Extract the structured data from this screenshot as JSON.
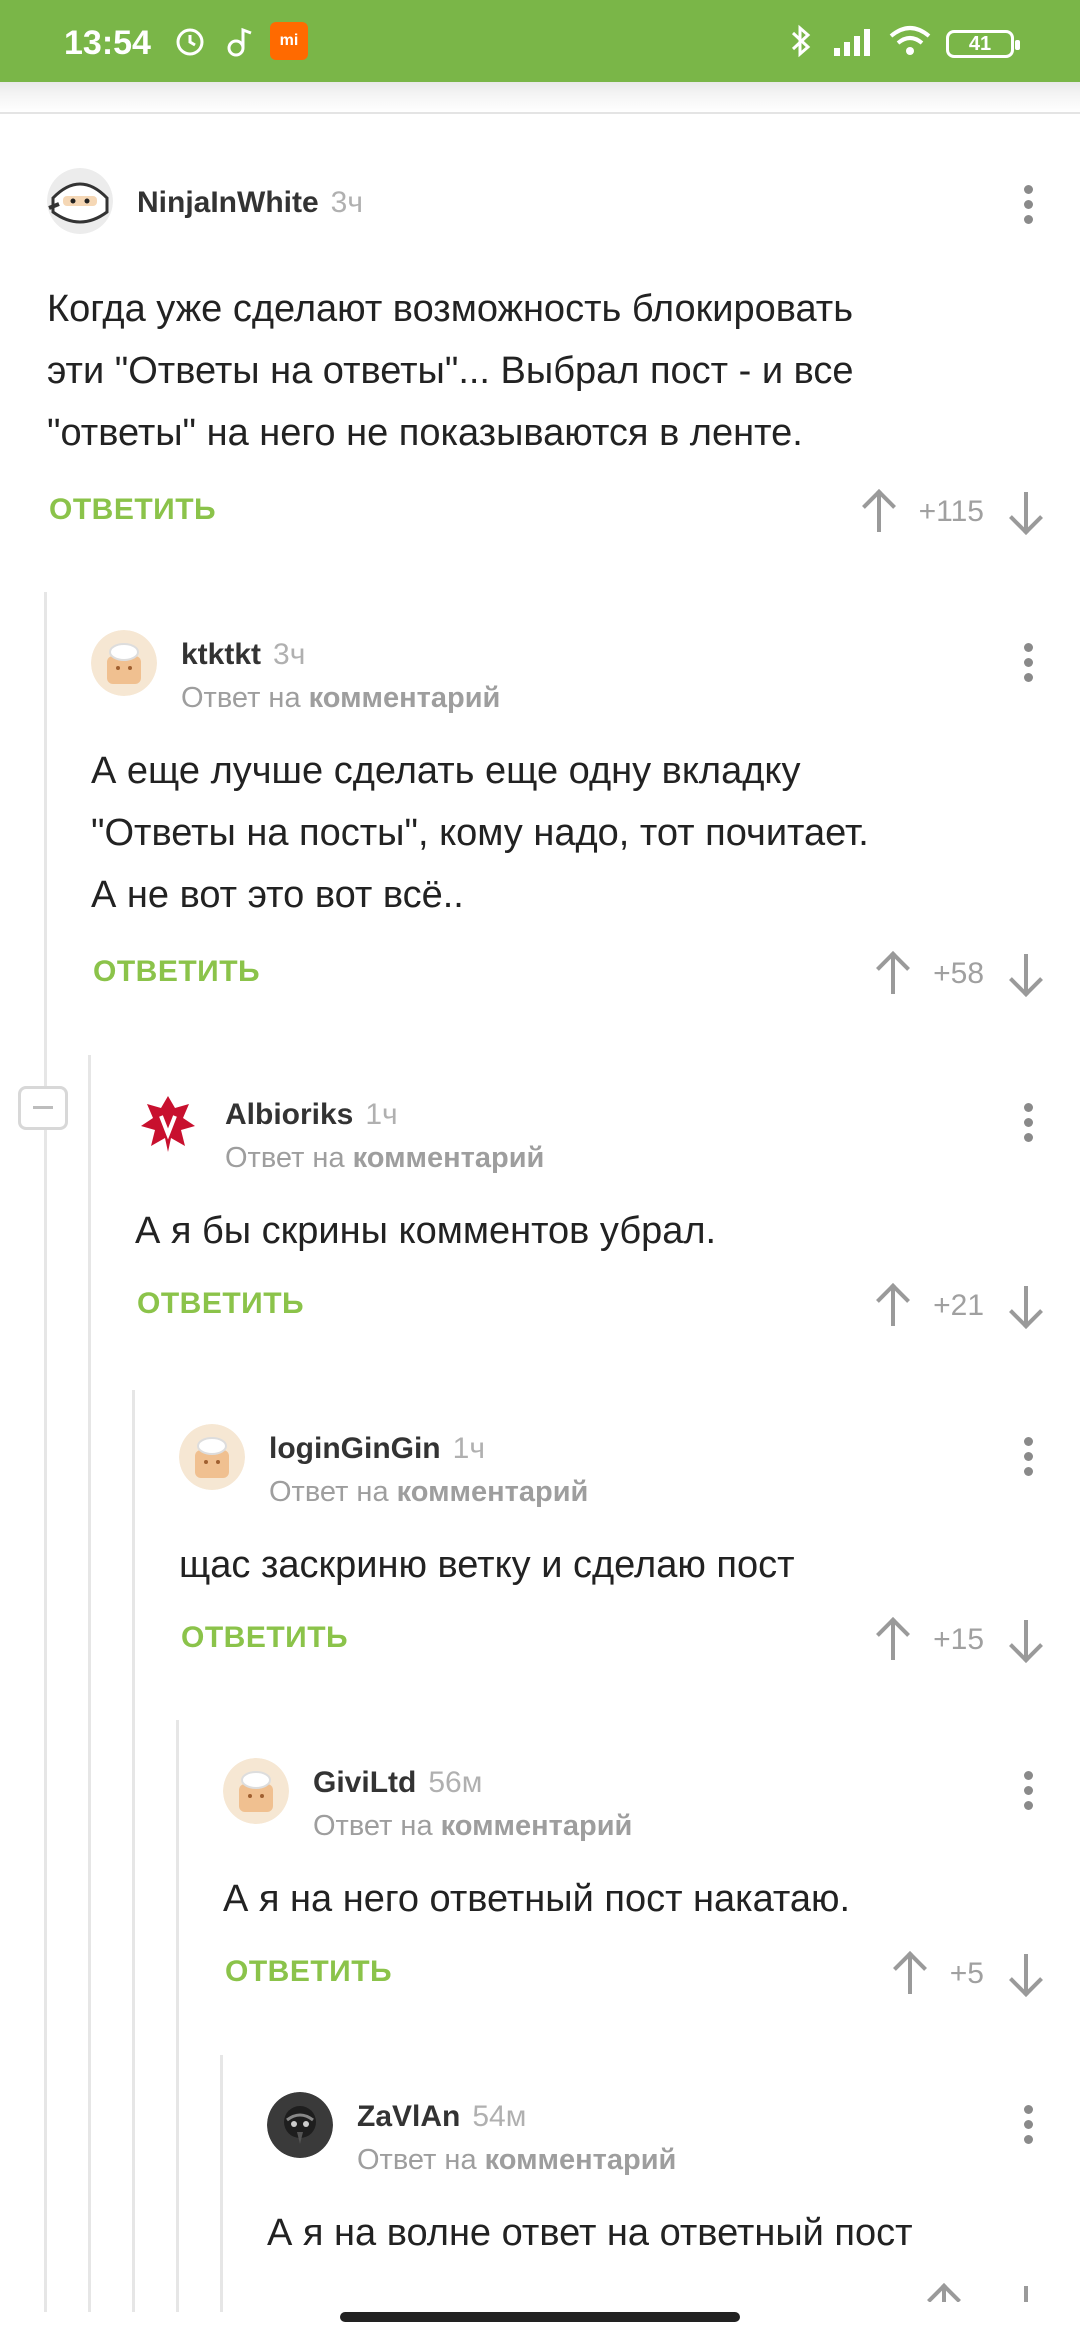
{
  "status_bar": {
    "time": "13:54",
    "battery": "41"
  },
  "reply_label": "ОТВЕТИТЬ",
  "reply_to_prefix": "Ответ на",
  "reply_to_target": "комментарий",
  "comments": [
    {
      "author": "NinjaInWhite",
      "time": "3ч",
      "lines": [
        "Когда уже сделают возможность блокировать",
        "эти \"Ответы на ответы\"... Выбрал пост - и все",
        "\"ответы\" на него не показываются в ленте."
      ],
      "score": "+115"
    },
    {
      "author": "ktktkt",
      "time": "3ч",
      "lines": [
        "А еще лучше сделать еще одну вкладку",
        "\"Ответы на посты\", кому надо, тот почитает.",
        "А не вот это вот всё.."
      ],
      "score": "+58"
    },
    {
      "author": "Albioriks",
      "time": "1ч",
      "lines": [
        "А я бы скрины комментов убрал."
      ],
      "score": "+21"
    },
    {
      "author": "loginGinGin",
      "time": "1ч",
      "lines": [
        "щас заскриню ветку и сделаю пост"
      ],
      "score": "+15"
    },
    {
      "author": "GiviLtd",
      "time": "56м",
      "lines": [
        "А я на него ответный пост накатаю."
      ],
      "score": "+5"
    },
    {
      "author": "ZaVlAn",
      "time": "54м",
      "lines": [
        "А я на волне ответ на ответный пост"
      ],
      "score": ""
    }
  ],
  "colors": {
    "accent": "#8bc34a",
    "status_bar": "#7ab648"
  }
}
